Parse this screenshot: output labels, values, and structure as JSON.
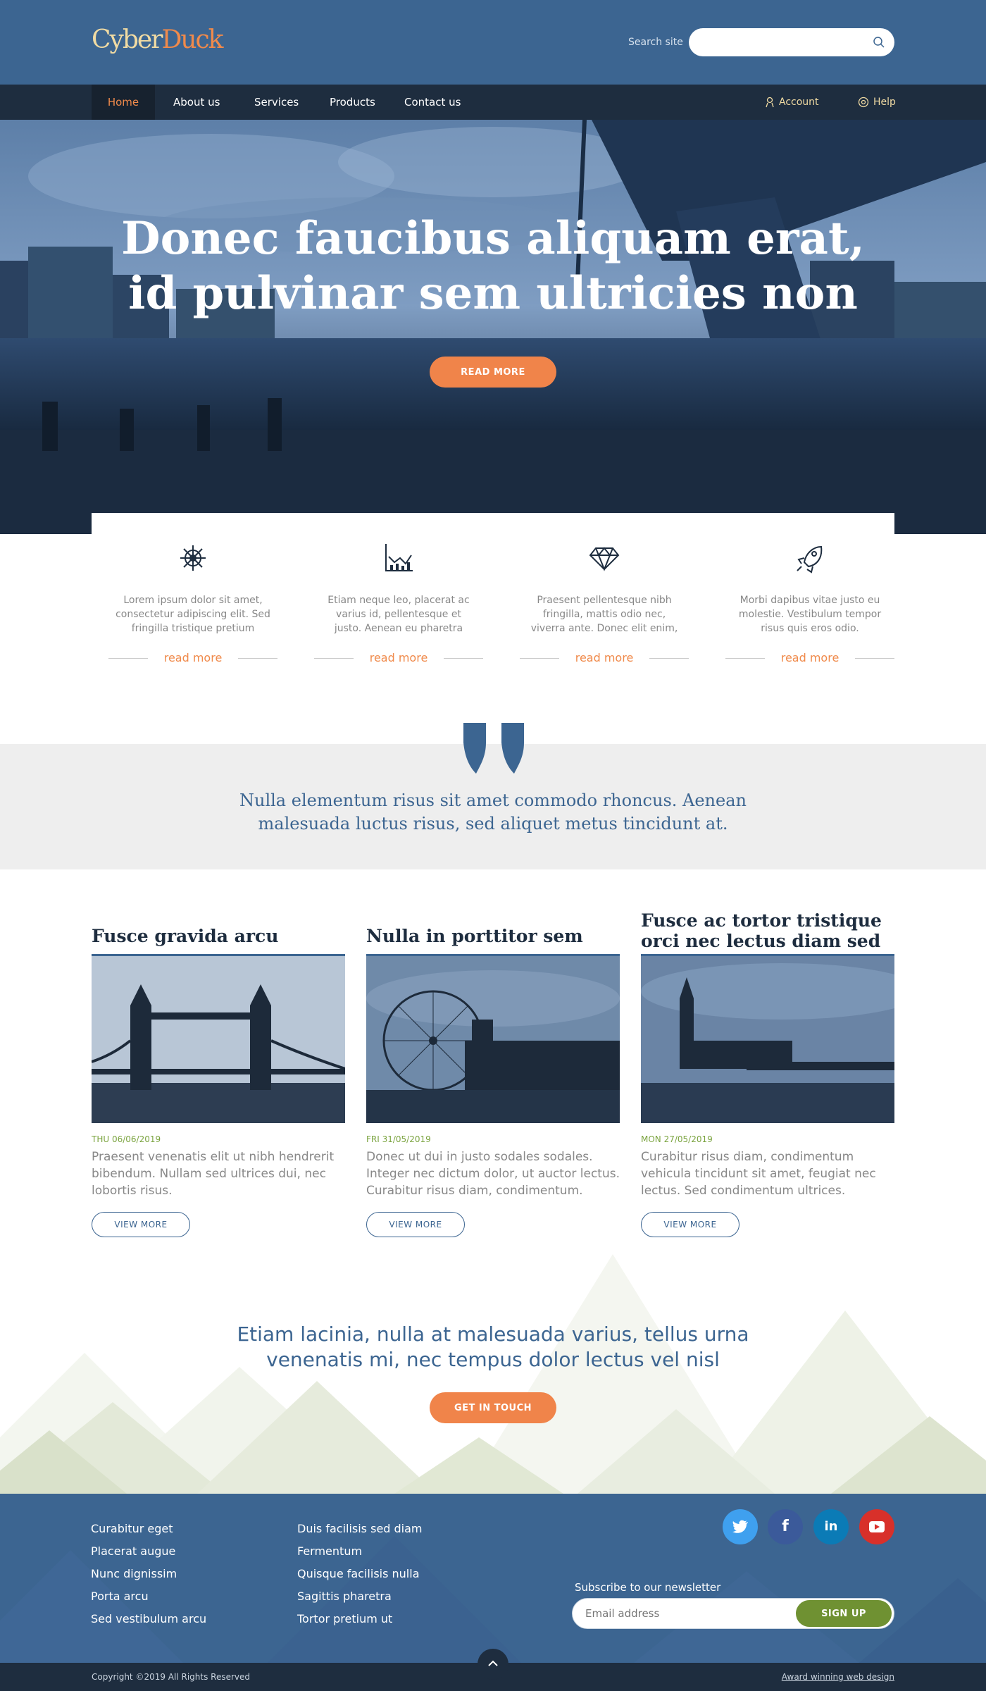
{
  "header": {
    "logo_part1": "Cyber",
    "logo_part2": "Duck",
    "search_label": "Search site",
    "search_placeholder": ""
  },
  "nav": {
    "items": [
      "Home",
      "About us",
      "Services",
      "Products",
      "Contact us"
    ],
    "account": "Account",
    "help": "Help"
  },
  "hero": {
    "title_line1": "Donec faucibus aliquam erat,",
    "title_line2": "id pulvinar sem ultricies non",
    "button": "READ MORE"
  },
  "features": [
    {
      "icon": "ship-wheel-icon",
      "text": "Lorem ipsum dolor sit amet, consectetur adipiscing elit. Sed fringilla tristique pretium",
      "link": "read more"
    },
    {
      "icon": "chart-icon",
      "text": "Etiam neque leo, placerat ac varius id, pellentesque et justo. Aenean eu pharetra",
      "link": "read more"
    },
    {
      "icon": "diamond-icon",
      "text": "Praesent pellentesque nibh fringilla, mattis odio nec, viverra ante. Donec elit enim,",
      "link": "read more"
    },
    {
      "icon": "rocket-icon",
      "text": "Morbi dapibus vitae justo eu molestie. Vestibulum tempor risus quis eros odio.",
      "link": "read more"
    }
  ],
  "quote": {
    "text": "Nulla elementum risus sit amet commodo rhoncus. Aenean malesuada luctus risus, sed aliquet metus tincidunt at."
  },
  "cards": [
    {
      "title": "Fusce gravida arcu",
      "date": "THU 06/06/2019",
      "text": "Praesent venenatis elit ut nibh hendrerit bibendum. Nullam sed ultrices dui, nec lobortis risus.",
      "button": "VIEW MORE"
    },
    {
      "title": "Nulla in porttitor sem",
      "date": "FRI 31/05/2019",
      "text": "Donec ut dui in justo sodales sodales. Integer nec dictum dolor, ut auctor lectus. Curabitur risus diam, condimentum.",
      "button": "VIEW MORE"
    },
    {
      "title": "Fusce ac tortor tristique orci nec lectus diam sed",
      "date": "MON 27/05/2019",
      "text": "Curabitur risus diam, condimentum vehicula tincidunt sit amet, feugiat nec lectus. Sed condimentum ultrices.",
      "button": "VIEW MORE"
    }
  ],
  "cta": {
    "text": "Etiam lacinia, nulla at malesuada varius, tellus urna venenatis mi, nec tempus dolor lectus vel nisl",
    "button": "GET IN TOUCH"
  },
  "footer": {
    "col1": [
      "Curabitur eget",
      "Placerat augue",
      "Nunc dignissim",
      "Porta arcu",
      "Sed vestibulum arcu"
    ],
    "col2": [
      "Duis facilisis sed diam",
      "Fermentum",
      "Quisque facilisis nulla",
      "Sagittis pharetra",
      "Tortor pretium ut"
    ],
    "social": [
      {
        "name": "twitter-icon",
        "glyph": "t",
        "color": "#3fa0ef"
      },
      {
        "name": "facebook-icon",
        "glyph": "f",
        "color": "#3b5a9a"
      },
      {
        "name": "linkedin-icon",
        "glyph": "in",
        "color": "#0b7bb6"
      },
      {
        "name": "youtube-icon",
        "glyph": "▶",
        "color": "#d8302a"
      }
    ],
    "newsletter_label": "Subscribe to our newsletter",
    "email_placeholder": "Email address",
    "signup": "SIGN UP",
    "copyright": "Copyright  ©2019 All Rights Reserved",
    "award": "Award winning web design"
  },
  "colors": {
    "primary": "#3c6591",
    "accent": "#f0844a",
    "dark": "#1e2d3f",
    "green": "#6f9132"
  }
}
